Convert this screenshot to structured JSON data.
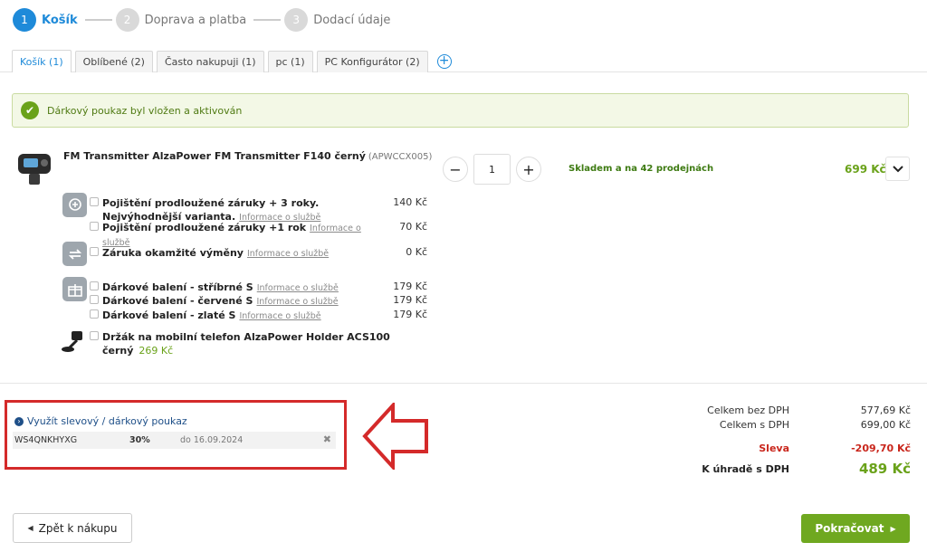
{
  "steps": [
    {
      "num": "1",
      "label": "Košík"
    },
    {
      "num": "2",
      "label": "Doprava a platba"
    },
    {
      "num": "3",
      "label": "Dodací údaje"
    }
  ],
  "tabs": [
    {
      "label": "Košík (1)"
    },
    {
      "label": "Oblíbené (2)"
    },
    {
      "label": "Často nakupuji (1)"
    },
    {
      "label": "pc (1)"
    },
    {
      "label": "PC Konfigurátor (2)"
    }
  ],
  "alert": {
    "text": "Dárkový poukaz byl vložen a aktivován"
  },
  "product": {
    "name": "FM Transmitter AlzaPower FM Transmitter F140 černý",
    "code": "(APWCCX005)",
    "quantity": "1",
    "stock": "Skladem a na 42 prodejnách",
    "price": "699 Kč"
  },
  "services": {
    "link_text": "Informace o službě",
    "insurance_3y": {
      "title": "Pojištění prodloužené záruky + 3 roky. Nejvýhodnější varianta.",
      "price": "140 Kč"
    },
    "insurance_1y": {
      "title": "Pojištění prodloužené záruky +1 rok",
      "price": "70 Kč"
    },
    "instant_exchange": {
      "title": "Záruka okamžité výměny",
      "price": "0 Kč"
    },
    "gift_silver": {
      "title": "Dárkové balení - stříbrné S",
      "price": "179 Kč"
    },
    "gift_red": {
      "title": "Dárkové balení - červené S",
      "price": "179 Kč"
    },
    "gift_gold": {
      "title": "Dárkové balení - zlaté S",
      "price": "179 Kč"
    },
    "holder": {
      "title": "Držák na mobilní telefon AlzaPower Holder ACS100 černý",
      "price": "269 Kč"
    }
  },
  "coupon": {
    "toggle_label": "Využít slevový / dárkový poukaz",
    "code": "WS4QNKHYXG",
    "percent": "30%",
    "valid_until": "do 16.09.2024",
    "remove_glyph": "✖"
  },
  "summary": {
    "without_vat_label": "Celkem bez DPH",
    "without_vat_value": "577,69 Kč",
    "with_vat_label": "Celkem s DPH",
    "with_vat_value": "699,00 Kč",
    "discount_label": "Sleva",
    "discount_value": "-209,70 Kč",
    "total_label": "K úhradě s DPH",
    "total_value": "489 Kč"
  },
  "buttons": {
    "back_label": "Zpět k nákupu",
    "next_label": "Pokračovat"
  },
  "colors": {
    "accent_blue": "#1e8ad9",
    "price_green": "#6aa21a",
    "discount_red": "#c9261c",
    "annotation_red": "#d42a2a",
    "button_green": "#6fa820"
  },
  "icons": [
    "check-icon",
    "minus-icon",
    "plus-icon",
    "chevron-down-icon",
    "insurance-icon",
    "exchange-icon",
    "gift-box-icon",
    "phone-holder-icon",
    "expand-circle-icon",
    "close-icon",
    "add-tab-icon",
    "arrow-left-annotation-icon"
  ]
}
